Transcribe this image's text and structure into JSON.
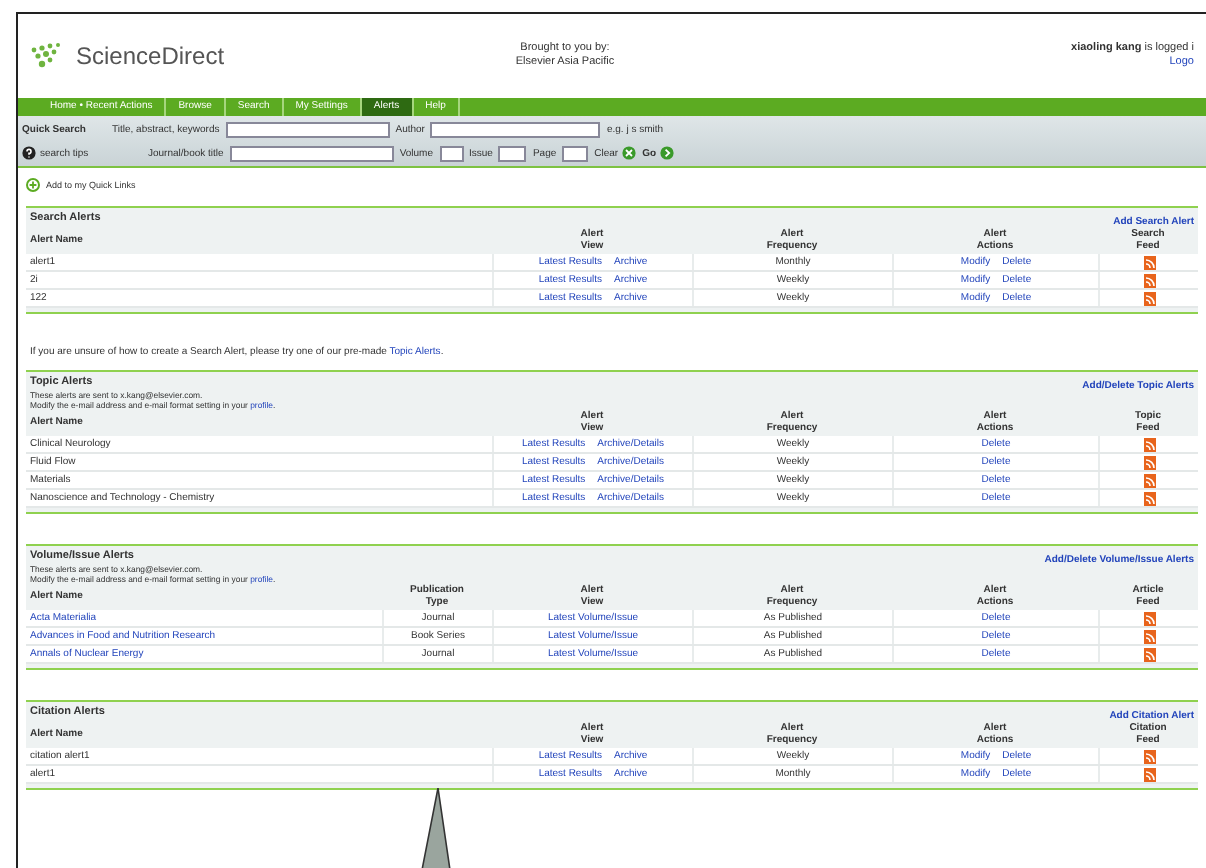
{
  "header": {
    "logo": "ScienceDirect",
    "brought_by": [
      "Brought to you by:",
      "Elsevier Asia Pacific"
    ],
    "user_name": "xiaoling kang",
    "user_status": "is logged i",
    "logout": "Logo"
  },
  "nav": [
    {
      "label": "Home • Recent Actions",
      "selected": false
    },
    {
      "label": "Browse",
      "selected": false
    },
    {
      "label": "Search",
      "selected": false
    },
    {
      "label": "My Settings",
      "selected": false
    },
    {
      "label": "Alerts",
      "selected": true
    },
    {
      "label": "Help",
      "selected": false
    }
  ],
  "quick_search": {
    "title": "Quick Search",
    "tips": "search tips",
    "row1": [
      {
        "label": "Title, abstract, keywords"
      },
      {
        "label": "Author"
      }
    ],
    "hint": "e.g. j s smith",
    "row2": [
      {
        "label": "Journal/book title"
      },
      {
        "label": "Volume"
      },
      {
        "label": "Issue"
      },
      {
        "label": "Page"
      }
    ],
    "clear": "Clear",
    "go": "Go"
  },
  "quick_links": "Add to my Quick Links",
  "sections": [
    {
      "title": "Search Alerts",
      "add_link": "Add Search Alert",
      "names_are_links": false,
      "columns": [
        {
          "kind": "name",
          "lines": [
            "Alert Name"
          ]
        },
        {
          "kind": "view",
          "lines": [
            "Alert",
            "View"
          ]
        },
        {
          "kind": "frequency",
          "lines": [
            "Alert",
            "Frequency"
          ]
        },
        {
          "kind": "actions",
          "lines": [
            "Alert",
            "Actions"
          ]
        },
        {
          "kind": "feed",
          "lines": [
            "Search",
            "Feed"
          ]
        }
      ],
      "rows": [
        {
          "name": "alert1",
          "view": [
            "Latest Results",
            "Archive"
          ],
          "frequency": "Monthly",
          "actions": [
            "Modify",
            "Delete"
          ]
        },
        {
          "name": "2i",
          "view": [
            "Latest Results",
            "Archive"
          ],
          "frequency": "Weekly",
          "actions": [
            "Modify",
            "Delete"
          ]
        },
        {
          "name": "122",
          "view": [
            "Latest Results",
            "Archive"
          ],
          "frequency": "Weekly",
          "actions": [
            "Modify",
            "Delete"
          ]
        }
      ],
      "after": {
        "text": "If you are unsure of how to create a Search Alert, please try one of our pre-made ",
        "link": "Topic Alerts",
        "end": "."
      }
    },
    {
      "title": "Topic Alerts",
      "add_link": "Add/Delete Topic Alerts",
      "names_are_links": false,
      "notes": [
        {
          "text": "These alerts are sent to x.kang@elsevier.com."
        },
        {
          "text": "Modify the e-mail address and e-mail format setting in your ",
          "link": "profile",
          "end": "."
        }
      ],
      "columns": [
        {
          "kind": "name",
          "lines": [
            "Alert Name"
          ]
        },
        {
          "kind": "view",
          "lines": [
            "Alert",
            "View"
          ]
        },
        {
          "kind": "frequency",
          "lines": [
            "Alert",
            "Frequency"
          ]
        },
        {
          "kind": "actions",
          "lines": [
            "Alert",
            "Actions"
          ]
        },
        {
          "kind": "feed",
          "lines": [
            "Topic",
            "Feed"
          ]
        }
      ],
      "rows": [
        {
          "name": "Clinical Neurology",
          "view": [
            "Latest Results",
            "Archive/Details"
          ],
          "frequency": "Weekly",
          "actions": [
            "Delete"
          ]
        },
        {
          "name": "Fluid Flow",
          "view": [
            "Latest Results",
            "Archive/Details"
          ],
          "frequency": "Weekly",
          "actions": [
            "Delete"
          ]
        },
        {
          "name": "Materials",
          "view": [
            "Latest Results",
            "Archive/Details"
          ],
          "frequency": "Weekly",
          "actions": [
            "Delete"
          ]
        },
        {
          "name": "Nanoscience and Technology - Chemistry",
          "view": [
            "Latest Results",
            "Archive/Details"
          ],
          "frequency": "Weekly",
          "actions": [
            "Delete"
          ]
        }
      ]
    },
    {
      "title": "Volume/Issue Alerts",
      "add_link": "Add/Delete Volume/Issue Alerts",
      "names_are_links": true,
      "notes": [
        {
          "text": "These alerts are sent to x.kang@elsevier.com."
        },
        {
          "text": "Modify the e-mail address and e-mail format setting in your ",
          "link": "profile",
          "end": "."
        }
      ],
      "columns": [
        {
          "kind": "name",
          "lines": [
            "Alert Name"
          ]
        },
        {
          "kind": "type",
          "lines": [
            "Publication",
            "Type"
          ]
        },
        {
          "kind": "view",
          "lines": [
            "Alert",
            "View"
          ]
        },
        {
          "kind": "frequency",
          "lines": [
            "Alert",
            "Frequency"
          ]
        },
        {
          "kind": "actions",
          "lines": [
            "Alert",
            "Actions"
          ]
        },
        {
          "kind": "feed",
          "lines": [
            "Article",
            "Feed"
          ]
        }
      ],
      "rows": [
        {
          "name": "Acta Materialia",
          "type": "Journal",
          "view": [
            "Latest Volume/Issue"
          ],
          "frequency": "As Published",
          "actions": [
            "Delete"
          ]
        },
        {
          "name": "Advances in Food and Nutrition Research",
          "type": "Book Series",
          "view": [
            "Latest Volume/Issue"
          ],
          "frequency": "As Published",
          "actions": [
            "Delete"
          ]
        },
        {
          "name": "Annals of Nuclear Energy",
          "type": "Journal",
          "view": [
            "Latest Volume/Issue"
          ],
          "frequency": "As Published",
          "actions": [
            "Delete"
          ]
        }
      ]
    },
    {
      "title": "Citation Alerts",
      "add_link": "Add Citation Alert",
      "names_are_links": false,
      "columns": [
        {
          "kind": "name",
          "lines": [
            "Alert Name"
          ]
        },
        {
          "kind": "view",
          "lines": [
            "Alert",
            "View"
          ]
        },
        {
          "kind": "frequency",
          "lines": [
            "Alert",
            "Frequency"
          ]
        },
        {
          "kind": "actions",
          "lines": [
            "Alert",
            "Actions"
          ]
        },
        {
          "kind": "feed",
          "lines": [
            "Citation",
            "Feed"
          ]
        }
      ],
      "rows": [
        {
          "name": "citation alert1",
          "view": [
            "Latest Results",
            "Archive"
          ],
          "frequency": "Weekly",
          "actions": [
            "Modify",
            "Delete"
          ]
        },
        {
          "name": "alert1",
          "view": [
            "Latest Results",
            "Archive"
          ],
          "frequency": "Monthly",
          "actions": [
            "Modify",
            "Delete"
          ]
        }
      ]
    }
  ]
}
